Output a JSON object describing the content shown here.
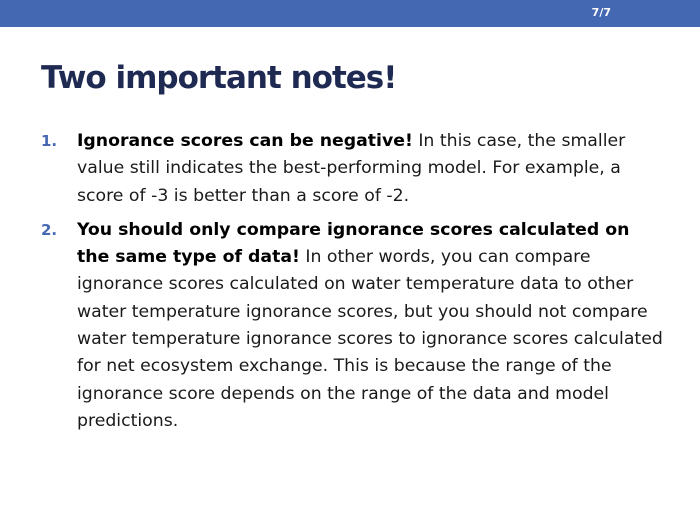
{
  "header": {
    "page_indicator": "7/7"
  },
  "slide": {
    "title": "Two important notes!",
    "notes": [
      {
        "number": "1.",
        "bold": "Ignorance scores can be negative!",
        "text": " In this case, the smaller value still indicates the best-performing model. For example, a score of -3 is better than a score of -2."
      },
      {
        "number": "2.",
        "bold": "You should only compare ignorance scores calculated on the same type of data!",
        "text": " In other words, you can compare ignorance scores calculated on water temperature data to other water temperature ignorance scores, but you should not compare water temperature ignorance scores to ignorance scores calculated for net ecosystem exchange. This is because the range of the ignorance score depends on the range of the data and model predictions."
      }
    ]
  },
  "colors": {
    "header_bar": "#4568b2",
    "title": "#1f2a52",
    "list_number": "#4568b2"
  }
}
